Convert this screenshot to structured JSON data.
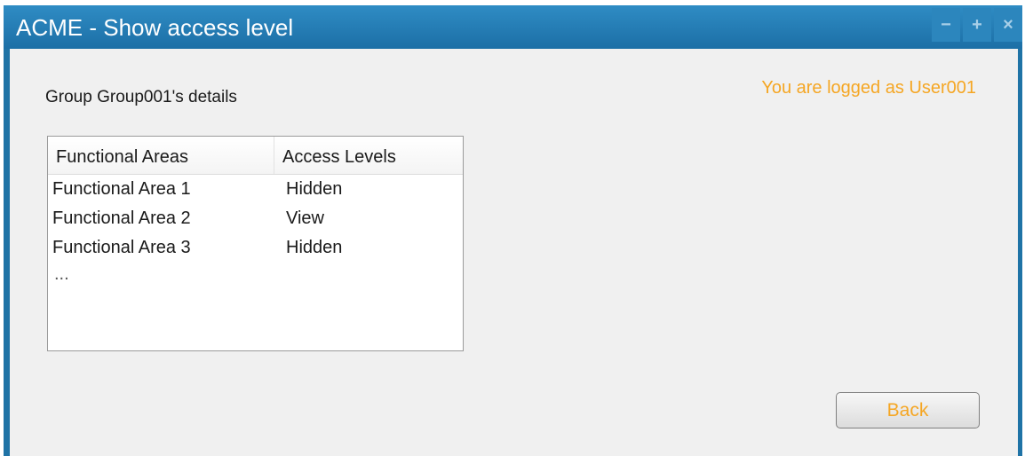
{
  "window": {
    "title": "ACME - Show access level",
    "controls": {
      "minimize": "−",
      "maximize": "+",
      "close": "×"
    }
  },
  "main": {
    "group_title": "Group Group001's details",
    "logged_as": "You are logged as User001",
    "table": {
      "headers": [
        "Functional Areas",
        "Access Levels"
      ],
      "rows": [
        [
          "Functional Area 1",
          "Hidden"
        ],
        [
          "Functional Area 2",
          "View"
        ],
        [
          "Functional Area 3",
          "Hidden"
        ]
      ],
      "more": "..."
    },
    "back_label": "Back"
  },
  "colors": {
    "titlebar": "#1f73a6",
    "accent_text": "#f5a623",
    "window_bg": "#f0f0f0"
  }
}
